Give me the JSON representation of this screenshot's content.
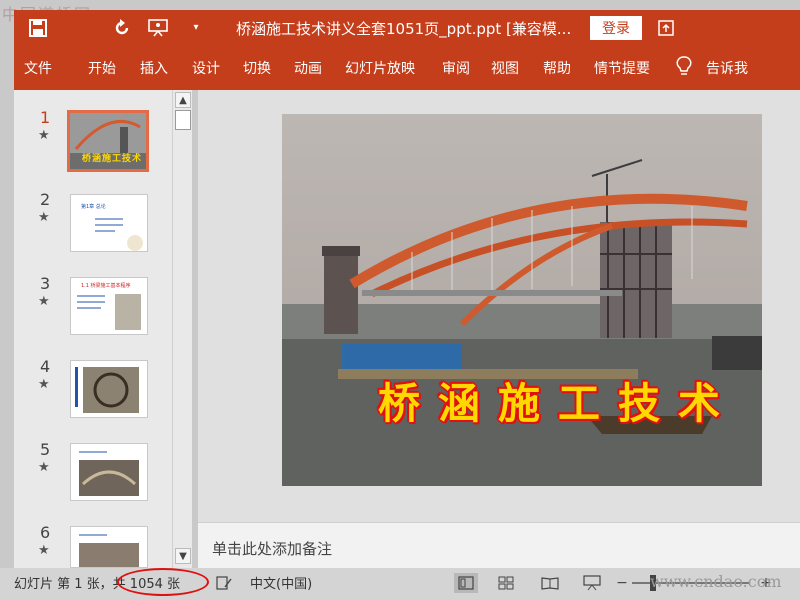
{
  "watermark": {
    "site_cn": "中国道桥网",
    "site_url": "www.cndao.com"
  },
  "titlebar": {
    "title": "桥涵施工技术讲义全套1051页_ppt.ppt [兼容模...",
    "login_label": "登录",
    "icons": [
      "save-icon",
      "undo-icon",
      "present-icon",
      "customize-icon",
      "restore-icon"
    ]
  },
  "ribbon": {
    "tabs": [
      "文件",
      "开始",
      "插入",
      "设计",
      "切换",
      "动画",
      "幻灯片放映",
      "审阅",
      "视图",
      "帮助",
      "情节提要"
    ],
    "tell_me": "告诉我"
  },
  "slides": [
    {
      "number": "1",
      "star": "★",
      "thumb_title": "桥涵施工技术"
    },
    {
      "number": "2",
      "star": "★",
      "thumb_title": "第1章  总论"
    },
    {
      "number": "3",
      "star": "★",
      "thumb_title": "1.1  桥梁施工基本程序"
    },
    {
      "number": "4",
      "star": "★",
      "thumb_title": ""
    },
    {
      "number": "5",
      "star": "★",
      "thumb_title": ""
    },
    {
      "number": "6",
      "star": "★",
      "thumb_title": ""
    }
  ],
  "main_slide": {
    "title": "桥涵施工技术"
  },
  "notes": {
    "placeholder": "单击此处添加备注"
  },
  "status": {
    "slide_info": "幻灯片 第 1 张，共 1054 张",
    "language": "中文(中国)"
  },
  "colors": {
    "accent": "#c43e1c",
    "slide_title": "#ffd800",
    "slide_title_outline": "#e01010"
  }
}
